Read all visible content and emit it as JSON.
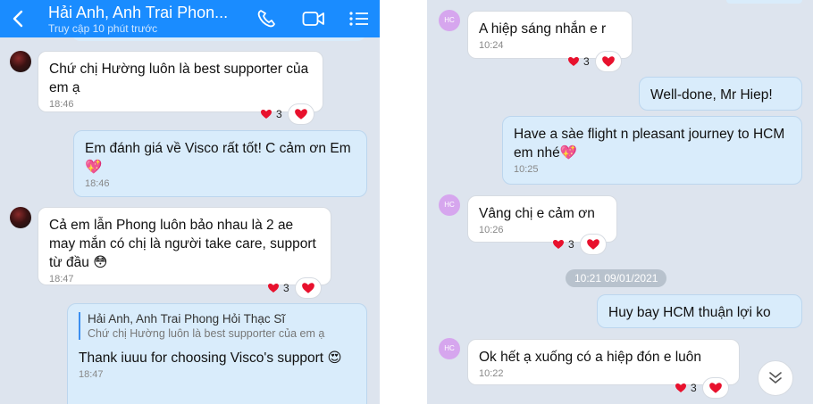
{
  "left": {
    "header": {
      "name": "Hải Anh, Anh Trai Phon...",
      "status": "Truy cập 10 phút trước"
    },
    "messages": [
      {
        "text": "Chứ chị Hường luôn là best supporter của em ạ",
        "time": "18:46",
        "reactions": "3"
      },
      {
        "text": "Em đánh giá về Visco rất tốt! C cảm ơn Em💖",
        "time": "18:46"
      },
      {
        "text": "Cả em lẫn Phong luôn bảo nhau là 2 ae may mắn có chị là người take care, support từ đầu 😳",
        "time": "18:47",
        "reactions": "3"
      },
      {
        "quote_author": "Hải Anh, Anh Trai Phong Hỏi Thạc Sĩ",
        "quote_text": "Chứ chị Hường luôn là best supporter của em ạ",
        "text": "Thank iuuu for choosing Visco's support 😍",
        "time": "18:47"
      }
    ]
  },
  "right": {
    "avatar_initials": "HC",
    "date_separator": "10:21 09/01/2021",
    "messages": [
      {
        "text": "A hiệp sáng nhắn e r",
        "time": "10:24",
        "reactions": "3"
      },
      {
        "text": "Well-done, Mr Hiep!"
      },
      {
        "text": "Have a sàe flight n pleasant journey to HCM em nhé💖",
        "time": "10:25"
      },
      {
        "text": "Vâng chị e cảm ơn",
        "time": "10:26",
        "reactions": "3"
      },
      {
        "text": "Huy bay HCM thuận lợi ko"
      },
      {
        "text": "Ok hết ạ xuống có a hiệp đón e luôn",
        "time": "10:22",
        "reactions": "3"
      }
    ]
  },
  "colors": {
    "header": "#1a8cff",
    "background": "#dde4ee",
    "outgoing": "#d9ecfb",
    "incoming": "#ffffff",
    "heart": "#e8112d"
  },
  "icons": [
    "back-arrow-icon",
    "phone-icon",
    "video-call-icon",
    "menu-list-icon",
    "heart-icon",
    "chevron-double-down-icon"
  ]
}
